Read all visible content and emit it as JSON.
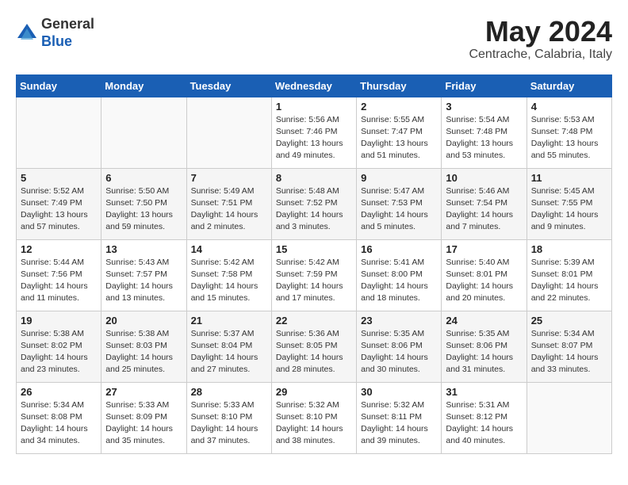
{
  "header": {
    "logo_general": "General",
    "logo_blue": "Blue",
    "month_title": "May 2024",
    "location": "Centrache, Calabria, Italy"
  },
  "calendar": {
    "day_headers": [
      "Sunday",
      "Monday",
      "Tuesday",
      "Wednesday",
      "Thursday",
      "Friday",
      "Saturday"
    ],
    "weeks": [
      {
        "days": [
          {
            "number": "",
            "info": ""
          },
          {
            "number": "",
            "info": ""
          },
          {
            "number": "",
            "info": ""
          },
          {
            "number": "1",
            "info": "Sunrise: 5:56 AM\nSunset: 7:46 PM\nDaylight: 13 hours\nand 49 minutes."
          },
          {
            "number": "2",
            "info": "Sunrise: 5:55 AM\nSunset: 7:47 PM\nDaylight: 13 hours\nand 51 minutes."
          },
          {
            "number": "3",
            "info": "Sunrise: 5:54 AM\nSunset: 7:48 PM\nDaylight: 13 hours\nand 53 minutes."
          },
          {
            "number": "4",
            "info": "Sunrise: 5:53 AM\nSunset: 7:48 PM\nDaylight: 13 hours\nand 55 minutes."
          }
        ]
      },
      {
        "days": [
          {
            "number": "5",
            "info": "Sunrise: 5:52 AM\nSunset: 7:49 PM\nDaylight: 13 hours\nand 57 minutes."
          },
          {
            "number": "6",
            "info": "Sunrise: 5:50 AM\nSunset: 7:50 PM\nDaylight: 13 hours\nand 59 minutes."
          },
          {
            "number": "7",
            "info": "Sunrise: 5:49 AM\nSunset: 7:51 PM\nDaylight: 14 hours\nand 2 minutes."
          },
          {
            "number": "8",
            "info": "Sunrise: 5:48 AM\nSunset: 7:52 PM\nDaylight: 14 hours\nand 3 minutes."
          },
          {
            "number": "9",
            "info": "Sunrise: 5:47 AM\nSunset: 7:53 PM\nDaylight: 14 hours\nand 5 minutes."
          },
          {
            "number": "10",
            "info": "Sunrise: 5:46 AM\nSunset: 7:54 PM\nDaylight: 14 hours\nand 7 minutes."
          },
          {
            "number": "11",
            "info": "Sunrise: 5:45 AM\nSunset: 7:55 PM\nDaylight: 14 hours\nand 9 minutes."
          }
        ]
      },
      {
        "days": [
          {
            "number": "12",
            "info": "Sunrise: 5:44 AM\nSunset: 7:56 PM\nDaylight: 14 hours\nand 11 minutes."
          },
          {
            "number": "13",
            "info": "Sunrise: 5:43 AM\nSunset: 7:57 PM\nDaylight: 14 hours\nand 13 minutes."
          },
          {
            "number": "14",
            "info": "Sunrise: 5:42 AM\nSunset: 7:58 PM\nDaylight: 14 hours\nand 15 minutes."
          },
          {
            "number": "15",
            "info": "Sunrise: 5:42 AM\nSunset: 7:59 PM\nDaylight: 14 hours\nand 17 minutes."
          },
          {
            "number": "16",
            "info": "Sunrise: 5:41 AM\nSunset: 8:00 PM\nDaylight: 14 hours\nand 18 minutes."
          },
          {
            "number": "17",
            "info": "Sunrise: 5:40 AM\nSunset: 8:01 PM\nDaylight: 14 hours\nand 20 minutes."
          },
          {
            "number": "18",
            "info": "Sunrise: 5:39 AM\nSunset: 8:01 PM\nDaylight: 14 hours\nand 22 minutes."
          }
        ]
      },
      {
        "days": [
          {
            "number": "19",
            "info": "Sunrise: 5:38 AM\nSunset: 8:02 PM\nDaylight: 14 hours\nand 23 minutes."
          },
          {
            "number": "20",
            "info": "Sunrise: 5:38 AM\nSunset: 8:03 PM\nDaylight: 14 hours\nand 25 minutes."
          },
          {
            "number": "21",
            "info": "Sunrise: 5:37 AM\nSunset: 8:04 PM\nDaylight: 14 hours\nand 27 minutes."
          },
          {
            "number": "22",
            "info": "Sunrise: 5:36 AM\nSunset: 8:05 PM\nDaylight: 14 hours\nand 28 minutes."
          },
          {
            "number": "23",
            "info": "Sunrise: 5:35 AM\nSunset: 8:06 PM\nDaylight: 14 hours\nand 30 minutes."
          },
          {
            "number": "24",
            "info": "Sunrise: 5:35 AM\nSunset: 8:06 PM\nDaylight: 14 hours\nand 31 minutes."
          },
          {
            "number": "25",
            "info": "Sunrise: 5:34 AM\nSunset: 8:07 PM\nDaylight: 14 hours\nand 33 minutes."
          }
        ]
      },
      {
        "days": [
          {
            "number": "26",
            "info": "Sunrise: 5:34 AM\nSunset: 8:08 PM\nDaylight: 14 hours\nand 34 minutes."
          },
          {
            "number": "27",
            "info": "Sunrise: 5:33 AM\nSunset: 8:09 PM\nDaylight: 14 hours\nand 35 minutes."
          },
          {
            "number": "28",
            "info": "Sunrise: 5:33 AM\nSunset: 8:10 PM\nDaylight: 14 hours\nand 37 minutes."
          },
          {
            "number": "29",
            "info": "Sunrise: 5:32 AM\nSunset: 8:10 PM\nDaylight: 14 hours\nand 38 minutes."
          },
          {
            "number": "30",
            "info": "Sunrise: 5:32 AM\nSunset: 8:11 PM\nDaylight: 14 hours\nand 39 minutes."
          },
          {
            "number": "31",
            "info": "Sunrise: 5:31 AM\nSunset: 8:12 PM\nDaylight: 14 hours\nand 40 minutes."
          },
          {
            "number": "",
            "info": ""
          }
        ]
      }
    ]
  }
}
